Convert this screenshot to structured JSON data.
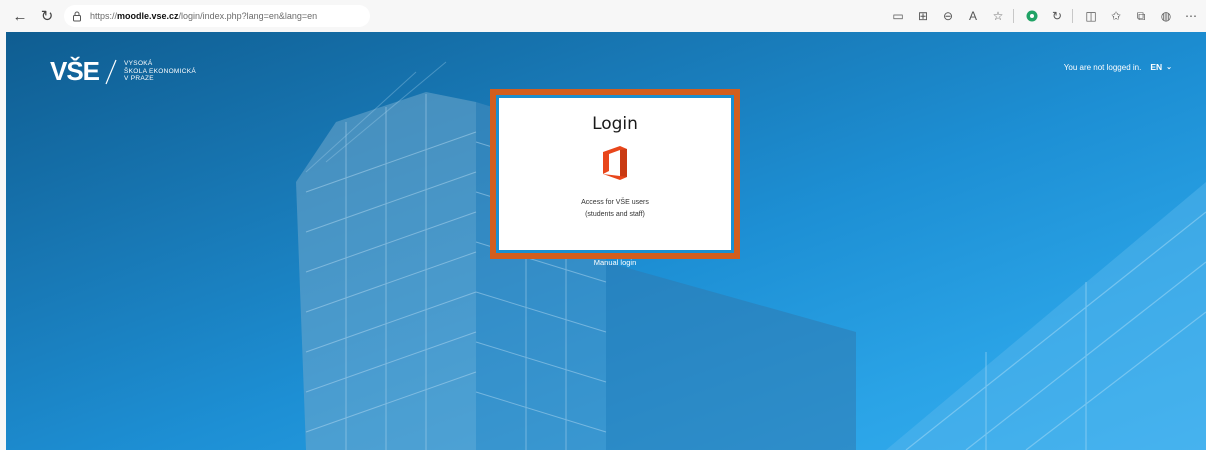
{
  "browser": {
    "url_prefix": "https://",
    "url_host": "moodle.vse.cz",
    "url_path": "/login/index.php?lang=en&lang=en"
  },
  "header": {
    "logo_mark": "VŠE",
    "logo_lines": [
      "VYSOKÁ",
      "ŠKOLA EKONOMICKÁ",
      "V PRAZE"
    ],
    "login_status": "You are not logged in.",
    "language": "EN"
  },
  "login_card": {
    "title": "Login",
    "description_line1": "Access for VŠE users",
    "description_line2": "(students and staff)"
  },
  "manual_login": "Manual login",
  "colors": {
    "accent_border": "#d35e1d",
    "office_red": "#e8461b",
    "background_blue": "#1d8fd4"
  },
  "icons": [
    "back-icon",
    "reload-icon",
    "page-info-icon",
    "office-logo-icon",
    "chevron-down-icon"
  ]
}
